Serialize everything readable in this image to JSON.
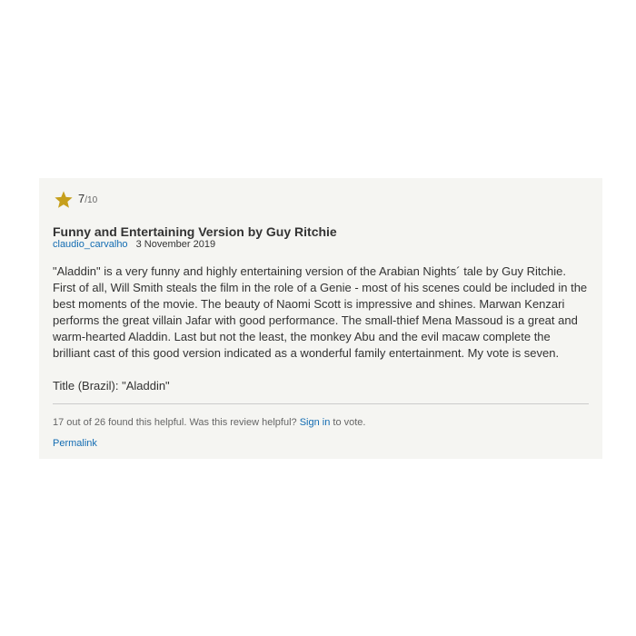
{
  "review": {
    "star_icon": "star-icon",
    "star_color": "#c69f1c",
    "rating": "7",
    "rating_max": "/10",
    "title": "Funny and Entertaining Version by Guy Ritchie",
    "author": "claudio_carvalho",
    "date": "3 November 2019",
    "body": "\"Aladdin\" is a very funny and highly entertaining version of the Arabian Nights´ tale by Guy Ritchie. First of all, Will Smith steals the film in the role of a Genie - most of his scenes could be included in the best moments of the movie. The beauty of Naomi Scott is impressive and shines. Marwan Kenzari performs the great villain Jafar with good performance. The small-thief Mena Massoud is a great and warm-hearted Aladdin. Last but not the least, the monkey Abu and the evil macaw complete the brilliant cast of this good version indicated as a wonderful family entertainment. My vote is seven.",
    "title_note": "Title (Brazil): \"Aladdin\"",
    "helpful_text": "17 out of 26 found this helpful. Was this review helpful?",
    "sign_in_label": "Sign in",
    "to_vote_text": "to vote.",
    "permalink_label": "Permalink",
    "link_color": "#136cb2",
    "card_background": "#f5f5f2"
  }
}
